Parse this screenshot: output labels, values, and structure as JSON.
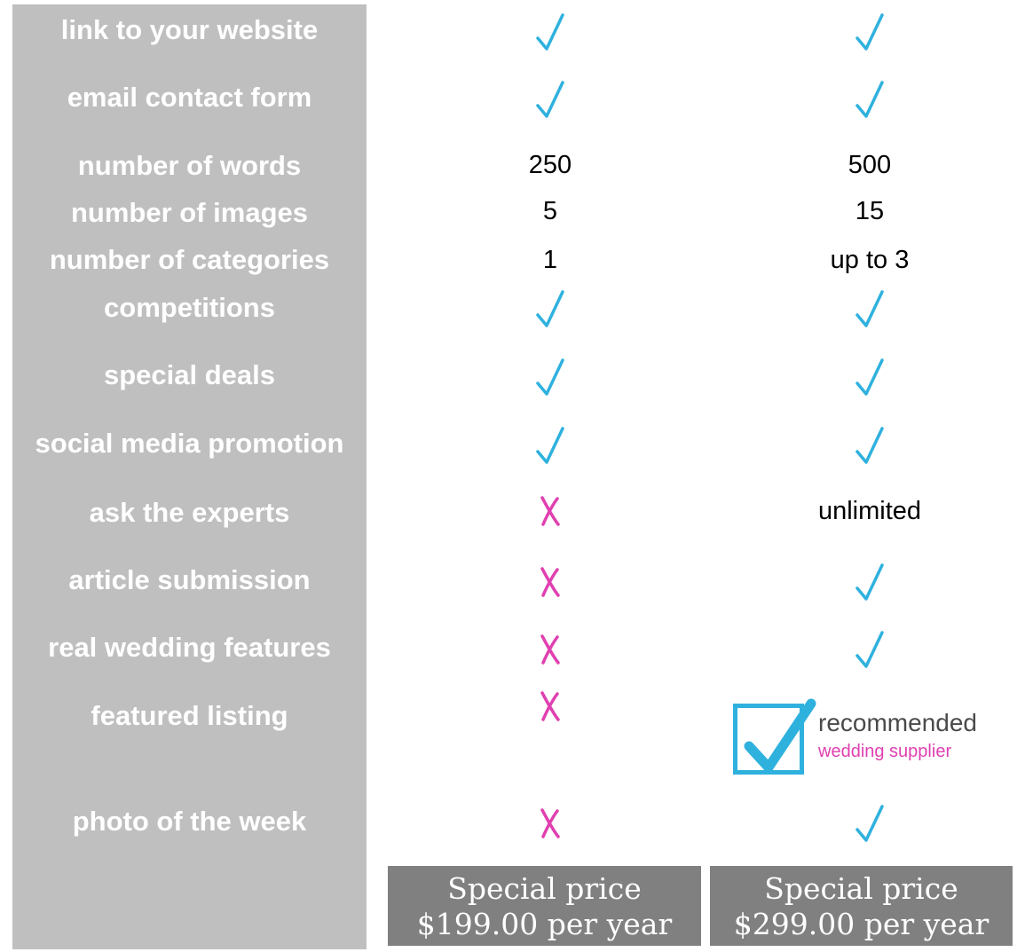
{
  "features": [
    {
      "label": "link to your website",
      "basic": {
        "type": "check"
      },
      "premium": {
        "type": "check"
      }
    },
    {
      "label": "email contact form",
      "basic": {
        "type": "check"
      },
      "premium": {
        "type": "check"
      }
    },
    {
      "label": "number of words",
      "basic": {
        "type": "text",
        "text": "250"
      },
      "premium": {
        "type": "text",
        "text": "500"
      }
    },
    {
      "label": "number of images",
      "basic": {
        "type": "text",
        "text": "5"
      },
      "premium": {
        "type": "text",
        "text": "15"
      }
    },
    {
      "label": "number of categories",
      "basic": {
        "type": "text",
        "text": "1"
      },
      "premium": {
        "type": "text",
        "text": "up to 3"
      }
    },
    {
      "label": "competitions",
      "basic": {
        "type": "check"
      },
      "premium": {
        "type": "check"
      }
    },
    {
      "label": "special deals",
      "basic": {
        "type": "check"
      },
      "premium": {
        "type": "check"
      }
    },
    {
      "label": "social media promotion",
      "basic": {
        "type": "check"
      },
      "premium": {
        "type": "check"
      }
    },
    {
      "label": "ask the experts",
      "basic": {
        "type": "cross"
      },
      "premium": {
        "type": "text",
        "text": "unlimited"
      }
    },
    {
      "label": "article submission",
      "basic": {
        "type": "cross"
      },
      "premium": {
        "type": "check"
      }
    },
    {
      "label": "real wedding features",
      "basic": {
        "type": "cross"
      },
      "premium": {
        "type": "check"
      }
    },
    {
      "label": "featured listing",
      "basic": {
        "type": "cross"
      },
      "premium": {
        "type": "badge"
      }
    },
    {
      "label": "photo of the week",
      "basic": {
        "type": "cross"
      },
      "premium": {
        "type": "check"
      }
    }
  ],
  "badge": {
    "line1": "recommended",
    "line2": "wedding supplier"
  },
  "prices": [
    {
      "line1": "Special price",
      "line2": "$199.00 per year"
    },
    {
      "line1": "Special price",
      "line2": "$299.00 per year"
    }
  ],
  "colors": {
    "check": "#2fb1de",
    "cross": "#e040b0",
    "label_panel": "#bfbfbf",
    "price_panel": "#808080"
  }
}
